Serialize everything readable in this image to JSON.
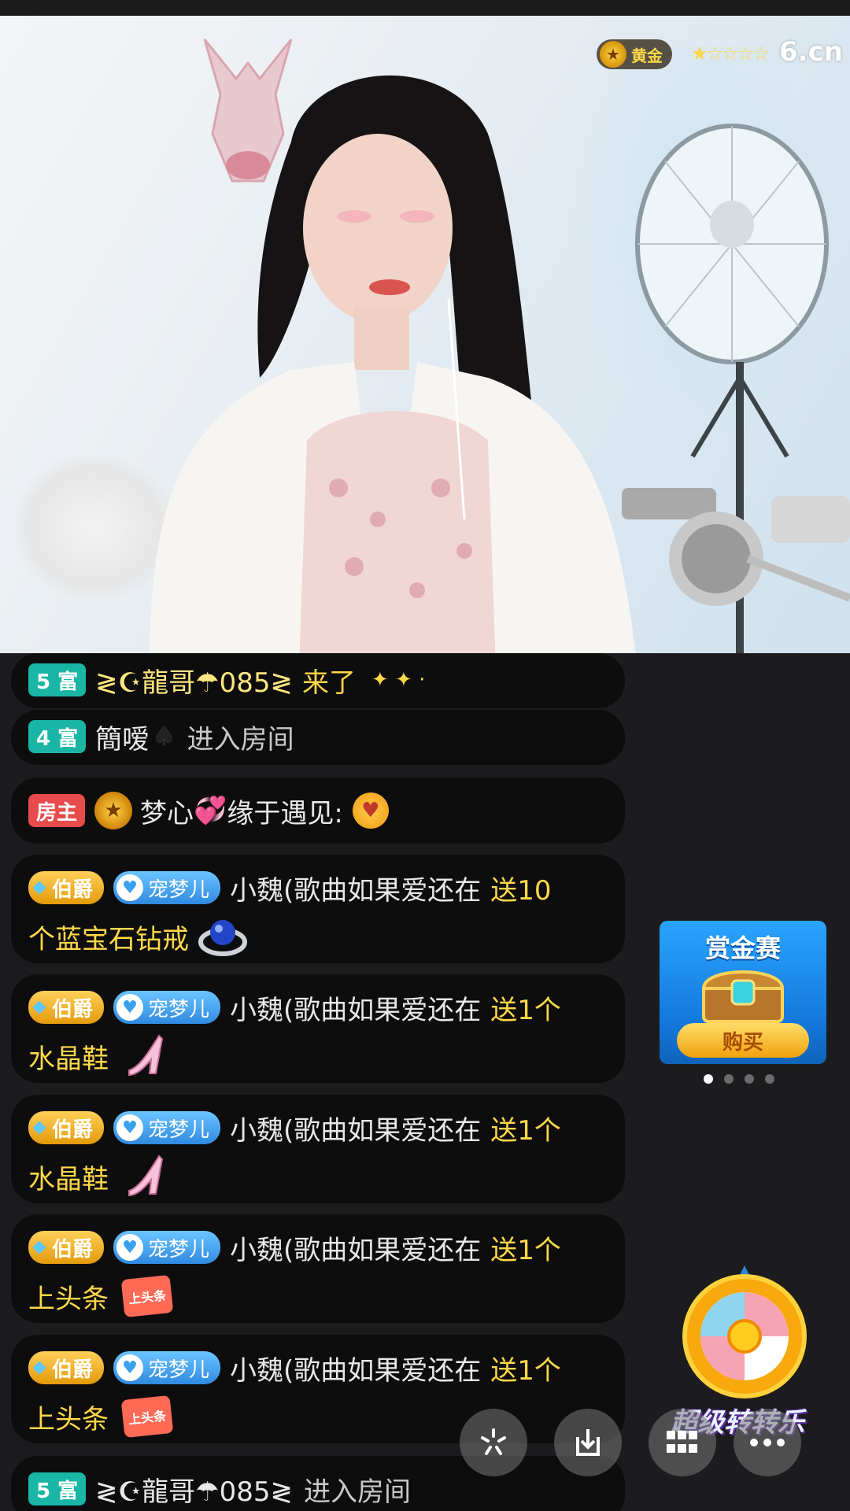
{
  "stream": {
    "level_label": "黄金",
    "stars_glyph": "★☆☆☆☆",
    "site_logo": "6.cn"
  },
  "chat": [
    {
      "badge": "5 富",
      "user": "≷☪龍哥☂085≷",
      "action": "来了"
    },
    {
      "badge": "4 富",
      "user": "簡嗳",
      "icon": "spade-icon",
      "action": "进入房间"
    },
    {
      "badge": "房主",
      "user": "梦心",
      "icon": "heart-icon",
      "text": "缘于遇见:",
      "emoji": "pray-emoji"
    },
    {
      "rank_badge": "伯爵",
      "club_badge": "宠梦儿",
      "user": "小魏(歌曲如果爱还在",
      "gift_line1": "送10",
      "gift_line2": "个蓝宝石钻戒",
      "gift_icon": "sapphire-ring-icon"
    },
    {
      "rank_badge": "伯爵",
      "club_badge": "宠梦儿",
      "user": "小魏(歌曲如果爱还在",
      "gift_line1": "送1个",
      "gift_line2": "水晶鞋",
      "gift_icon": "crystal-shoe-icon"
    },
    {
      "rank_badge": "伯爵",
      "club_badge": "宠梦儿",
      "user": "小魏(歌曲如果爱还在",
      "gift_line1": "送1个",
      "gift_line2": "水晶鞋",
      "gift_icon": "crystal-shoe-icon"
    },
    {
      "rank_badge": "伯爵",
      "club_badge": "宠梦儿",
      "user": "小魏(歌曲如果爱还在",
      "gift_line1": "送1个",
      "gift_line2": "上头条",
      "gift_icon": "headline-icon",
      "gift_icon_text": "上头条"
    },
    {
      "rank_badge": "伯爵",
      "club_badge": "宠梦儿",
      "user": "小魏(歌曲如果爱还在",
      "gift_line1": "送1个",
      "gift_line2": "上头条",
      "gift_icon": "headline-icon",
      "gift_icon_text": "上头条"
    },
    {
      "badge": "5 富",
      "user": "≷☪龍哥☂085≷",
      "action": "进入房间"
    }
  ],
  "promo": {
    "title": "赏金赛",
    "button": "购买",
    "page_count": 4,
    "active_page": 1
  },
  "wheel": {
    "label": "超级转转乐"
  },
  "controls": [
    {
      "name": "sparkle-icon"
    },
    {
      "name": "download-icon"
    },
    {
      "name": "grid-icon"
    },
    {
      "name": "more-icon"
    }
  ]
}
